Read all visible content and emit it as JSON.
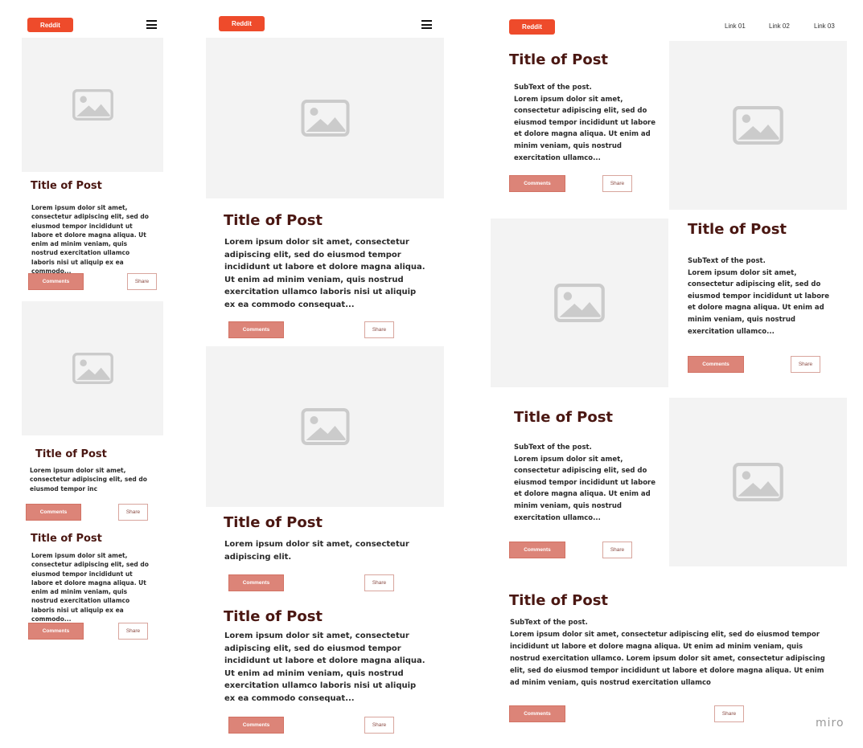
{
  "brand": "Reddit",
  "links": [
    "Link 01",
    "Link 02",
    "Link 03"
  ],
  "buttons": {
    "comments": "Comments",
    "share": "Share"
  },
  "watermark": "miro",
  "icons": {
    "menu": "hamburger-icon",
    "image": "image-placeholder-icon"
  },
  "colors": {
    "brand": "#ee4b2b",
    "comments_button": "#dc8478",
    "title": "#4a1712",
    "placeholder": "#f3f3f3"
  },
  "mobile": {
    "posts": [
      {
        "title": "Title of Post",
        "text": "Lorem ipsum dolor sit amet, consectetur adipiscing elit, sed do eiusmod tempor incididunt ut labore et dolore magna aliqua. Ut enim ad minim veniam, quis nostrud exercitation ullamco laboris nisi ut aliquip ex ea commodo..."
      },
      {
        "title": "Title of Post",
        "text": "Lorem ipsum dolor sit amet, consectetur adipiscing elit, sed do eiusmod tempor inc"
      },
      {
        "title": "Title of Post",
        "text": "Lorem ipsum dolor sit amet, consectetur adipiscing elit, sed do eiusmod tempor incididunt ut labore et dolore magna aliqua. Ut enim ad minim veniam, quis nostrud exercitation ullamco laboris nisi ut aliquip ex ea commodo..."
      }
    ]
  },
  "tablet": {
    "posts": [
      {
        "title": "Title of Post",
        "text": "Lorem ipsum dolor sit amet, consectetur adipiscing elit, sed do eiusmod tempor incididunt ut labore et dolore magna aliqua. Ut enim ad minim veniam, quis nostrud exercitation ullamco laboris nisi ut aliquip ex ea commodo consequat..."
      },
      {
        "title": "Title of Post",
        "text": "Lorem ipsum dolor sit amet, consectetur adipiscing elit."
      },
      {
        "title": "Title of Post",
        "text": "Lorem ipsum dolor sit amet, consectetur adipiscing elit, sed do eiusmod tempor incididunt ut labore et dolore magna aliqua. Ut enim ad minim veniam, quis nostrud exercitation ullamco laboris nisi ut aliquip ex ea commodo consequat..."
      }
    ]
  },
  "desktop": {
    "posts": [
      {
        "title": "Title of Post",
        "subtext": "SubText of the post.",
        "text": "Lorem ipsum dolor sit amet, consectetur adipiscing elit, sed do eiusmod tempor incididunt ut labore et dolore magna aliqua. Ut enim ad minim veniam, quis nostrud exercitation ullamco..."
      },
      {
        "title": "Title of Post",
        "subtext": "SubText of the post.",
        "text": "Lorem ipsum dolor sit amet, consectetur adipiscing elit, sed do eiusmod tempor incididunt ut labore et dolore magna aliqua. Ut enim ad minim veniam, quis nostrud exercitation ullamco..."
      },
      {
        "title": "Title of Post",
        "subtext": "SubText of the post.",
        "text": "Lorem ipsum dolor sit amet, consectetur adipiscing elit, sed do eiusmod tempor incididunt ut labore et dolore magna aliqua. Ut enim ad minim veniam, quis nostrud exercitation ullamco..."
      },
      {
        "title": "Title of Post",
        "subtext": "SubText of the post.",
        "text": "Lorem ipsum dolor sit amet, consectetur adipiscing elit, sed do eiusmod tempor incididunt ut labore et dolore magna aliqua. Ut enim ad minim veniam, quis nostrud exercitation ullamco. Lorem ipsum dolor sit amet, consectetur adipiscing elit, sed do eiusmod tempor incididunt ut labore et dolore magna aliqua. Ut enim ad minim veniam, quis nostrud exercitation ullamco"
      }
    ]
  }
}
